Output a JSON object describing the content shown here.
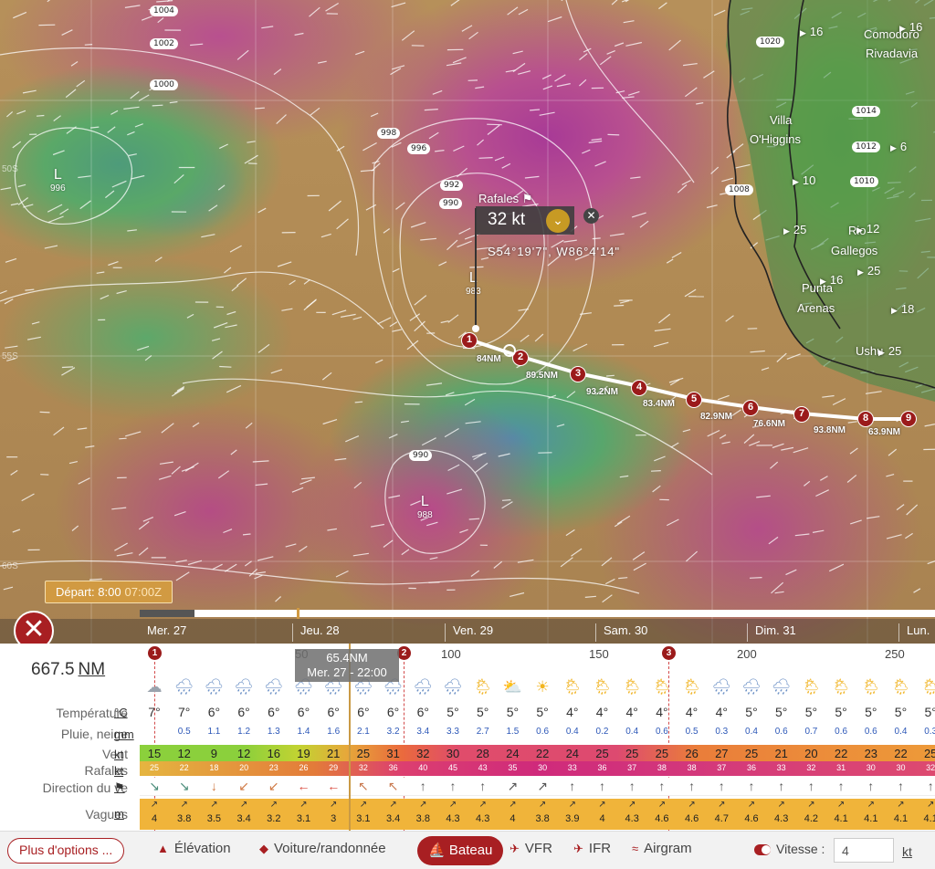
{
  "map": {
    "isobars": [
      {
        "label": "1004"
      },
      {
        "label": "1002"
      },
      {
        "label": "1000"
      },
      {
        "label": "998"
      },
      {
        "label": "996"
      },
      {
        "label": "992"
      },
      {
        "label": "990"
      },
      {
        "label": "990"
      },
      {
        "label": "1020"
      },
      {
        "label": "1014"
      },
      {
        "label": "1012"
      },
      {
        "label": "1010"
      },
      {
        "label": "1008"
      }
    ],
    "lows": [
      {
        "letter": "L",
        "pressure": "996"
      },
      {
        "letter": "L",
        "pressure": "983"
      },
      {
        "letter": "L",
        "pressure": "988"
      }
    ],
    "cities": [
      "Comodoro",
      "Rivadavia",
      "Villa",
      "O'Higgins",
      "Rio",
      "Gallegos",
      "Punta",
      "Arenas",
      "Ushu"
    ],
    "wind_badges": [
      "16",
      "16",
      "6",
      "10",
      "12",
      "25",
      "16",
      "25",
      "18",
      "25"
    ],
    "lat_labels": [
      "50S",
      "55S",
      "60S"
    ],
    "waypoints": [
      "1",
      "2",
      "3",
      "4",
      "5",
      "6",
      "7",
      "8",
      "9"
    ],
    "legs": [
      "84NM",
      "89.5NM",
      "93.2NM",
      "83.4NM",
      "82.9NM",
      "76.6NM",
      "93.8NM",
      "63.9NM"
    ],
    "popup": {
      "title": "Rafales",
      "value": "32 kt",
      "coords": "S54°19'7\", W86°4'14\""
    }
  },
  "timeline": {
    "departure_label": "Départ: 8:00",
    "departure_utc": "07:00Z",
    "days": [
      "Mer. 27",
      "Jeu. 28",
      "Ven. 29",
      "Sam. 30",
      "Dim. 31",
      "Lun."
    ]
  },
  "panel": {
    "total_distance": "667.5",
    "total_distance_unit": "NM",
    "distance_ticks": [
      "50",
      "100",
      "150",
      "200",
      "250"
    ],
    "route_markers": [
      "1",
      "2",
      "3"
    ],
    "cursor": {
      "distance": "65.4NM",
      "time": "Mer. 27 - 22:00"
    },
    "rows": {
      "temperature": {
        "label": "Température",
        "unit": "°C"
      },
      "rain": {
        "label": "Pluie, neige",
        "unit": "mm"
      },
      "wind": {
        "label": "Vent",
        "unit": "kt"
      },
      "gust": {
        "label": "Rafales",
        "unit": "kt"
      },
      "direction": {
        "label": "Direction du ve",
        "unit": "flag-icon"
      },
      "waves": {
        "label": "Vagues",
        "unit": "m"
      }
    },
    "weather_icons": [
      "cloud",
      "rain",
      "rain",
      "rain",
      "rain",
      "rain",
      "rain",
      "rain",
      "rain",
      "rain",
      "rain",
      "sun-rain",
      "sun-cloud",
      "sun",
      "sun-rain",
      "sun-rain",
      "sun-rain",
      "sun-rain",
      "sun-rain",
      "rain",
      "rain",
      "rain",
      "sun-rain",
      "sun-rain",
      "sun-rain",
      "sun-rain",
      "sun-rain"
    ],
    "temperature": [
      "7°",
      "7°",
      "6°",
      "6°",
      "6°",
      "6°",
      "6°",
      "6°",
      "6°",
      "6°",
      "5°",
      "5°",
      "5°",
      "5°",
      "4°",
      "4°",
      "4°",
      "4°",
      "4°",
      "4°",
      "5°",
      "5°",
      "5°",
      "5°",
      "5°",
      "5°",
      "5°"
    ],
    "rain": [
      "",
      "0.5",
      "1.1",
      "1.2",
      "1.3",
      "1.4",
      "1.6",
      "2.1",
      "3.2",
      "3.4",
      "3.3",
      "2.7",
      "1.5",
      "0.6",
      "0.4",
      "0.2",
      "0.4",
      "0.6",
      "0.5",
      "0.3",
      "0.4",
      "0.6",
      "0.7",
      "0.6",
      "0.6",
      "0.4",
      "0.3"
    ],
    "wind": [
      "15",
      "12",
      "9",
      "12",
      "16",
      "19",
      "21",
      "25",
      "31",
      "32",
      "30",
      "28",
      "24",
      "22",
      "24",
      "25",
      "25",
      "25",
      "26",
      "27",
      "25",
      "21",
      "20",
      "22",
      "23",
      "22",
      "25"
    ],
    "gust": [
      "25",
      "22",
      "18",
      "20",
      "23",
      "26",
      "29",
      "32",
      "36",
      "40",
      "45",
      "43",
      "35",
      "30",
      "33",
      "36",
      "37",
      "38",
      "38",
      "37",
      "36",
      "33",
      "32",
      "31",
      "30",
      "30",
      "32"
    ],
    "direction": [
      "↘",
      "↘",
      "↓",
      "↙",
      "↙",
      "←",
      "←",
      "↖",
      "↖",
      "↑",
      "↑",
      "↑",
      "↗",
      "↗",
      "↑",
      "↑",
      "↑",
      "↑",
      "↑",
      "↑",
      "↑",
      "↑",
      "↑",
      "↑",
      "↑",
      "↑",
      "↑"
    ],
    "waves": [
      "4",
      "3.8",
      "3.5",
      "3.4",
      "3.2",
      "3.1",
      "3",
      "3.1",
      "3.4",
      "3.8",
      "4.3",
      "4.3",
      "4",
      "3.8",
      "3.9",
      "4",
      "4.3",
      "4.6",
      "4.6",
      "4.7",
      "4.6",
      "4.3",
      "4.2",
      "4.1",
      "4.1",
      "4.1",
      "4.1"
    ]
  },
  "bottom_bar": {
    "more_options": "Plus d'options ...",
    "modes": {
      "elevation": "Élévation",
      "car": "Voiture/randonnée",
      "boat": "Bateau",
      "vfr": "VFR",
      "ifr": "IFR",
      "airgram": "Airgram"
    },
    "speed_label": "Vitesse :",
    "speed_value": "4",
    "speed_unit": "kt"
  }
}
